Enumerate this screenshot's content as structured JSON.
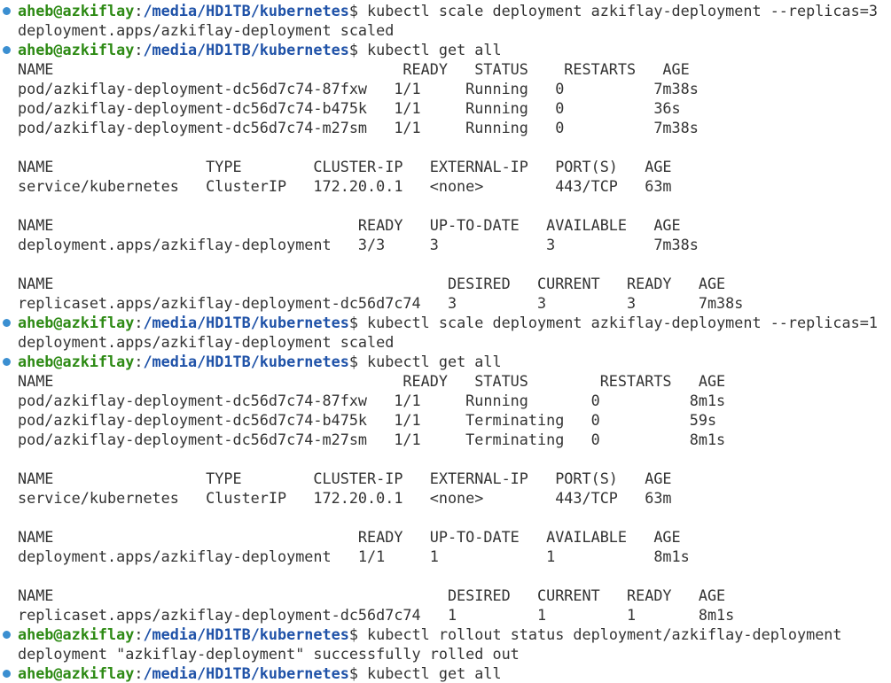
{
  "prompt": {
    "user_host": "aheb@azkiflay",
    "separator": ":",
    "path": "/media/HD1TB/kubernetes",
    "symbol": "$ "
  },
  "colors": {
    "user": "#2d8a14",
    "path": "#1f52a8",
    "dot": "#3b8fd1",
    "text": "#333333",
    "background": "#ffffff"
  },
  "lines": [
    {
      "type": "prompt",
      "command": "kubectl scale deployment azkiflay-deployment --replicas=3"
    },
    {
      "type": "output",
      "text": "deployment.apps/azkiflay-deployment scaled"
    },
    {
      "type": "prompt",
      "command": "kubectl get all"
    },
    {
      "type": "output",
      "text": "NAME                                       READY   STATUS    RESTARTS   AGE"
    },
    {
      "type": "output",
      "text": "pod/azkiflay-deployment-dc56d7c74-87fxw   1/1     Running   0          7m38s"
    },
    {
      "type": "output",
      "text": "pod/azkiflay-deployment-dc56d7c74-b475k   1/1     Running   0          36s"
    },
    {
      "type": "output",
      "text": "pod/azkiflay-deployment-dc56d7c74-m27sm   1/1     Running   0          7m38s"
    },
    {
      "type": "output",
      "text": ""
    },
    {
      "type": "output",
      "text": "NAME                 TYPE        CLUSTER-IP   EXTERNAL-IP   PORT(S)   AGE"
    },
    {
      "type": "output",
      "text": "service/kubernetes   ClusterIP   172.20.0.1   <none>        443/TCP   63m"
    },
    {
      "type": "output",
      "text": ""
    },
    {
      "type": "output",
      "text": "NAME                                  READY   UP-TO-DATE   AVAILABLE   AGE"
    },
    {
      "type": "output",
      "text": "deployment.apps/azkiflay-deployment   3/3     3            3           7m38s"
    },
    {
      "type": "output",
      "text": ""
    },
    {
      "type": "output",
      "text": "NAME                                            DESIRED   CURRENT   READY   AGE"
    },
    {
      "type": "output",
      "text": "replicaset.apps/azkiflay-deployment-dc56d7c74   3         3         3       7m38s"
    },
    {
      "type": "prompt",
      "command": "kubectl scale deployment azkiflay-deployment --replicas=1"
    },
    {
      "type": "output",
      "text": "deployment.apps/azkiflay-deployment scaled"
    },
    {
      "type": "prompt",
      "command": "kubectl get all"
    },
    {
      "type": "output",
      "text": "NAME                                       READY   STATUS        RESTARTS   AGE"
    },
    {
      "type": "output",
      "text": "pod/azkiflay-deployment-dc56d7c74-87fxw   1/1     Running       0          8m1s"
    },
    {
      "type": "output",
      "text": "pod/azkiflay-deployment-dc56d7c74-b475k   1/1     Terminating   0          59s"
    },
    {
      "type": "output",
      "text": "pod/azkiflay-deployment-dc56d7c74-m27sm   1/1     Terminating   0          8m1s"
    },
    {
      "type": "output",
      "text": ""
    },
    {
      "type": "output",
      "text": "NAME                 TYPE        CLUSTER-IP   EXTERNAL-IP   PORT(S)   AGE"
    },
    {
      "type": "output",
      "text": "service/kubernetes   ClusterIP   172.20.0.1   <none>        443/TCP   63m"
    },
    {
      "type": "output",
      "text": ""
    },
    {
      "type": "output",
      "text": "NAME                                  READY   UP-TO-DATE   AVAILABLE   AGE"
    },
    {
      "type": "output",
      "text": "deployment.apps/azkiflay-deployment   1/1     1            1           8m1s"
    },
    {
      "type": "output",
      "text": ""
    },
    {
      "type": "output",
      "text": "NAME                                            DESIRED   CURRENT   READY   AGE"
    },
    {
      "type": "output",
      "text": "replicaset.apps/azkiflay-deployment-dc56d7c74   1         1         1       8m1s"
    },
    {
      "type": "prompt",
      "command": "kubectl rollout status deployment/azkiflay-deployment"
    },
    {
      "type": "output",
      "text": "deployment \"azkiflay-deployment\" successfully rolled out"
    },
    {
      "type": "prompt",
      "command": "kubectl get all"
    }
  ]
}
